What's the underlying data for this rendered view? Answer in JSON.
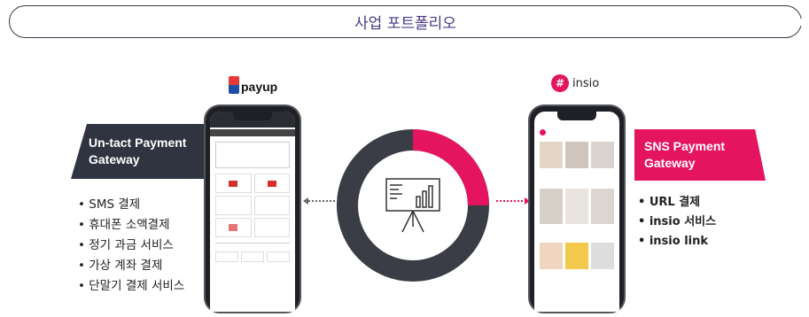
{
  "header": {
    "title": "사업 포트폴리오"
  },
  "left": {
    "logo_text": "payup",
    "band_lines": [
      "Un-tact Payment",
      "Gateway"
    ],
    "bullets": [
      "SMS 결제",
      "휴대폰 소액결제",
      "정기 과금 서비스",
      "가상 계좌 결제",
      "단말기 결제 서비스"
    ]
  },
  "right": {
    "logo_text": "insio",
    "band_lines": [
      "SNS Payment",
      "Gateway"
    ],
    "bullets": [
      "URL 결제",
      "insio 서비스",
      "insio link"
    ]
  },
  "colors": {
    "accent_pink": "#e5145f",
    "dark": "#2f3440",
    "ring_gray": "#3a3d45"
  },
  "center": {
    "icon": "presentation-chart-icon"
  }
}
